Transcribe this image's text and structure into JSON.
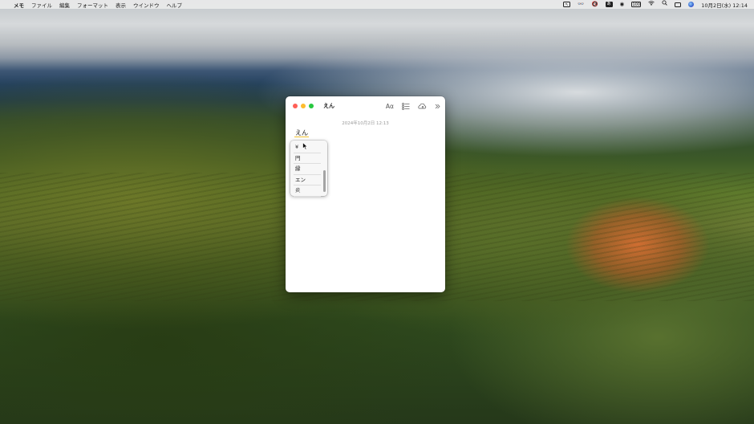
{
  "menubar": {
    "apple": "",
    "app_name": "メモ",
    "menus": [
      "ファイル",
      "編集",
      "フォーマット",
      "表示",
      "ウインドウ",
      "ヘルプ"
    ],
    "status": {
      "input_mode": "あ",
      "battery": "100",
      "datetime": "10月2日(水)  12:14"
    }
  },
  "notes": {
    "title": "えん",
    "toolbar": {
      "format": "Aα"
    },
    "date": "2024年10月2日 12:13",
    "body_composing": "えん"
  },
  "ime": {
    "candidates": [
      "¥",
      "円",
      "縁",
      "エン",
      "炎"
    ]
  }
}
